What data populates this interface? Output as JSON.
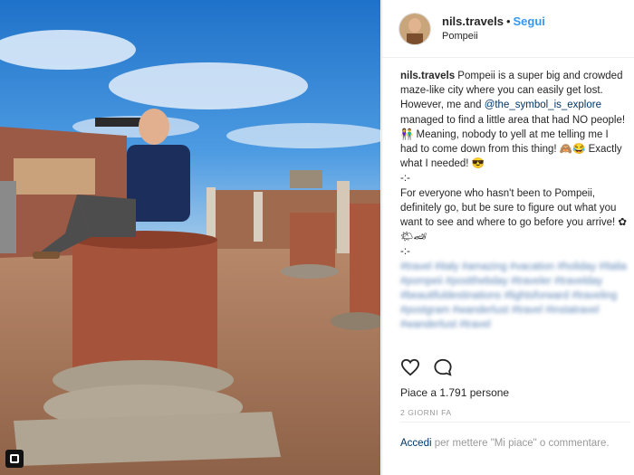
{
  "post": {
    "username": "nils.travels",
    "separator": "•",
    "follow_label": "Segui",
    "location": "Pompeii",
    "caption": {
      "username": "nils.travels",
      "p1": " Pompeii is a super big and crowded maze-like city where you can easily get lost. However, me and ",
      "mention": "@the_symbol_is_explore",
      "p2": " managed to find a little area that had NO people! 👫 Meaning, nobody to yell at me telling me I had to come down from this thing! 🙈😂 Exactly what I needed! 😎",
      "sep1": "-:-",
      "p3": "For everyone who hasn't been to Pompeii, definitely go, but be sure to figure out what you want to see and where to go before you arrive! ✿🌤🏎",
      "sep2": "-:-",
      "hashtags": "#travel #italy #amazing #vacation #holiday #Italia #pompeii #postthebday #traveler #travelday #beautifuldestinations #lightsforward #traveling #postgram #wanderlust #travel #instatravel #wanderlust #travel"
    },
    "likes_text": "Piace a 1.791 persone",
    "time_ago": "2 GIORNI FA",
    "login": {
      "link": "Accedi",
      "rest": " per mettere \"Mi piace\" o commentare."
    }
  },
  "icons": {
    "like": "heart-outline-icon",
    "comment": "speech-bubble-icon",
    "gallery": "gallery-icon"
  },
  "colors": {
    "follow": "#3897f0",
    "link": "#003569",
    "muted": "#999999",
    "text": "#262626"
  }
}
